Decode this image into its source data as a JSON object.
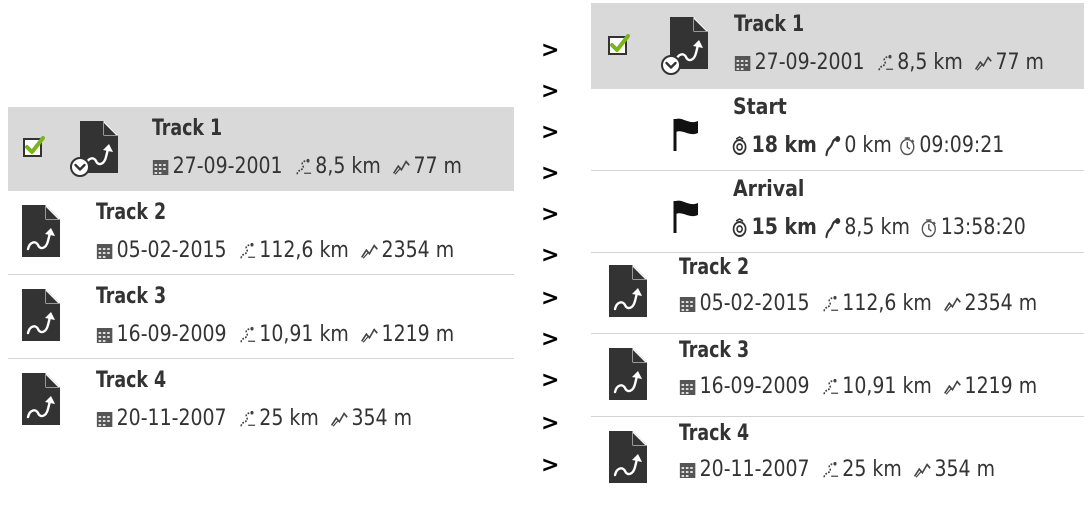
{
  "left": {
    "tracks": [
      {
        "title": "Track 1",
        "date": "27-09-2001",
        "distance": "8,5 km",
        "elevation": "77 m",
        "selected": true
      },
      {
        "title": "Track 2",
        "date": "05-02-2015",
        "distance": "112,6 km",
        "elevation": "2354 m"
      },
      {
        "title": "Track 3",
        "date": "16-09-2009",
        "distance": "10,91 km",
        "elevation": "1219 m"
      },
      {
        "title": "Track 4",
        "date": "20-11-2007",
        "distance": "25 km",
        "elevation": "354 m"
      }
    ]
  },
  "chevrons": [
    ">",
    ">",
    ">",
    ">",
    ">",
    ">",
    ">",
    ">",
    ">",
    ">",
    ">"
  ],
  "right": {
    "selected_track": {
      "title": "Track 1",
      "date": "27-09-2001",
      "distance": "8,5 km",
      "elevation": "77 m"
    },
    "waypoints": [
      {
        "title": "Start",
        "remaining": "18 km",
        "from_start": "0 km",
        "time": "09:09:21"
      },
      {
        "title": "Arrival",
        "remaining": "15 km",
        "from_start": "8,5 km",
        "time": "13:58:20"
      }
    ],
    "tracks": [
      {
        "title": "Track 2",
        "date": "05-02-2015",
        "distance": "112,6 km",
        "elevation": "2354 m"
      },
      {
        "title": "Track 3",
        "date": "16-09-2009",
        "distance": "10,91 km",
        "elevation": "1219 m"
      },
      {
        "title": "Track 4",
        "date": "20-11-2007",
        "distance": "25 km",
        "elevation": "354 m"
      }
    ]
  },
  "icons": {
    "checkbox": "checkbox-checked-icon",
    "track": "track-file-icon",
    "expand": "expand-badge-icon",
    "date": "calendar-icon",
    "distance": "route-distance-icon",
    "elevation": "elevation-icon",
    "flag": "flag-icon",
    "remaining": "target-distance-icon",
    "from_start": "route-start-icon",
    "time": "clock-icon"
  },
  "colors": {
    "selected_bg": "#d9d9d9",
    "check_green": "#7cb518",
    "icon_dark": "#333333",
    "separator": "#d4d4d4"
  }
}
